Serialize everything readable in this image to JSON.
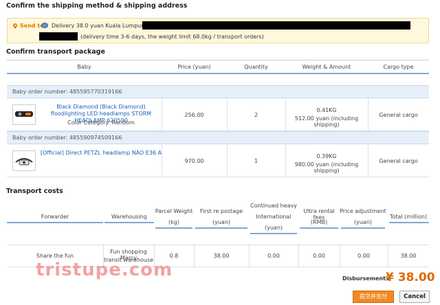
{
  "section_shipping": {
    "title": "Confirm the shipping method & shipping address"
  },
  "send_to": {
    "label": "Send to",
    "line1": "Delivery 38.0 yuan Kuala Lumpur",
    "line2": "(delivery time 3-6 days, the weight limit 68.0kg / transport orders)"
  },
  "section_package": {
    "title": "Confirm transport package"
  },
  "package_columns": [
    "Baby",
    "Price (yuan)",
    "Quantity",
    "Weight & Amount",
    "Cargo type"
  ],
  "orders": [
    {
      "order_label": "Baby order number: 485595770319166",
      "item_name": "Black Diamond (Black Diamond) floodlighting LED headlamps STORM HEADLAMP 620590",
      "item_attr": "Color Category: Random",
      "price": "256.00",
      "quantity": "2",
      "weight": "0.41KG",
      "amount": "512.00 yuan (including shipping)",
      "cargo_type": "General cargo"
    },
    {
      "order_label": "Baby order number: 485590974509166",
      "item_name": "[Official] Direct PETZL headlamp NAO E36 A",
      "item_attr": "",
      "price": "970.00",
      "quantity": "1",
      "weight": "0.39KG",
      "amount": "980.00 yuan (including shipping)",
      "cargo_type": "General cargo"
    }
  ],
  "section_costs": {
    "title": "Transport costs"
  },
  "cost_columns": {
    "forwarder": "Forwarder",
    "warehousing": "Warehousing",
    "parcel_weight": "Parcel Weight",
    "parcel_weight_unit": "(kg)",
    "first_postage": "First re postage",
    "first_postage_unit": "(yuan)",
    "continued_heavy_1": "Continued heavy",
    "continued_heavy_2": "International",
    "continued_heavy_unit": "(yuan)",
    "rental_fees": "Ultra rental fees",
    "rental_fees_unit": "(RMB)",
    "price_adjustment": "Price adjustment",
    "price_adjustment_unit": "(yuan)",
    "total": "Total (million)"
  },
  "cost_row": {
    "forwarder": "Share the fun",
    "warehousing_1": "Fun shopping Marcy",
    "warehousing_2": "transit warehouse",
    "parcel_weight": "0.8",
    "first_postage": "38.00",
    "continued_heavy": "0.00",
    "rental_fees": "0.00",
    "price_adjustment": "0.00",
    "total": "38.00"
  },
  "watermark": "tristupe.com",
  "disbursements": {
    "label": "Disbursements:",
    "amount": "¥ 38.00"
  },
  "buttons": {
    "submit": "提交并支付",
    "cancel": "Cancel"
  },
  "colors": {
    "accent": "#e06a00",
    "link": "#1a5fb4",
    "table_rule": "#7fa6d6",
    "banner_bg": "#fff8dc"
  }
}
